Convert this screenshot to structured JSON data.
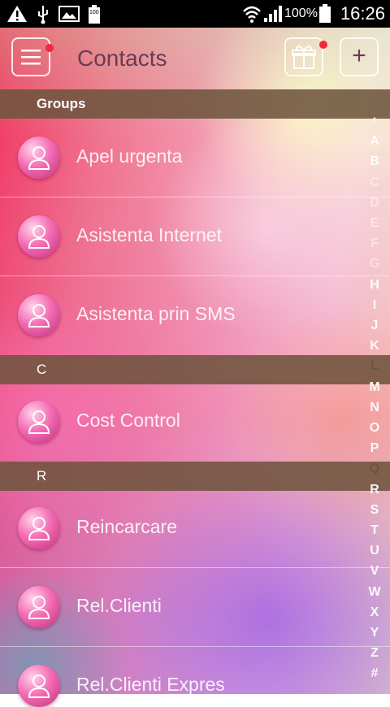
{
  "status_bar": {
    "battery_percent": "100%",
    "time": "16:26",
    "battery_small_label": "100"
  },
  "header": {
    "title": "Contacts",
    "add_label": "+"
  },
  "sections": [
    {
      "label": "Groups"
    },
    {
      "label": "C"
    },
    {
      "label": "R"
    }
  ],
  "contacts": [
    {
      "name": "Apel urgenta"
    },
    {
      "name": "Asistenta Internet"
    },
    {
      "name": "Asistenta prin SMS"
    },
    {
      "name": "Cost Control"
    },
    {
      "name": "Reincarcare"
    },
    {
      "name": "Rel.Clienti"
    },
    {
      "name": "Rel.Clienti Expres"
    }
  ],
  "alphabet_index": [
    "↑",
    "A",
    "B",
    "C",
    "D",
    "E",
    "F",
    "G",
    "H",
    "I",
    "J",
    "K",
    "L",
    "M",
    "N",
    "O",
    "P",
    "Q",
    "R",
    "S",
    "T",
    "U",
    "V",
    "W",
    "X",
    "Y",
    "Z",
    "#"
  ],
  "colors": {
    "accent_text": "#6b3a52",
    "section_bg": "#6e543e",
    "notification_dot": "#f2283c"
  }
}
